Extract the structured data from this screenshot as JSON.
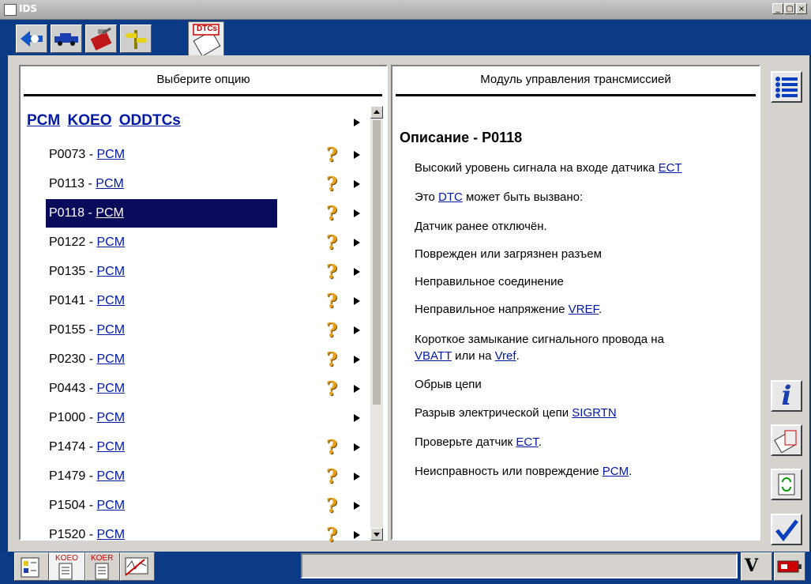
{
  "window": {
    "title": "IDS",
    "min_label": "_",
    "max_label": "▢",
    "close_label": "×"
  },
  "toolbar": {
    "tabs": [
      "back",
      "vehicle",
      "toolbox",
      "signpost"
    ],
    "dtc_tab_label": "DTCs"
  },
  "left_panel": {
    "header": "Выберите опцию",
    "group": {
      "pcm": "PCM",
      "koeo": "KOEO",
      "oddtcs": "ODDTCs"
    },
    "items": [
      {
        "code": "P0073",
        "sep": " - ",
        "module": "PCM",
        "help": true,
        "selected": false
      },
      {
        "code": "P0113",
        "sep": " - ",
        "module": "PCM",
        "help": true,
        "selected": false
      },
      {
        "code": "P0118",
        "sep": " - ",
        "module": "PCM",
        "help": true,
        "selected": true
      },
      {
        "code": "P0122",
        "sep": " - ",
        "module": "PCM",
        "help": true,
        "selected": false
      },
      {
        "code": "P0135",
        "sep": " - ",
        "module": "PCM",
        "help": true,
        "selected": false
      },
      {
        "code": "P0141",
        "sep": " - ",
        "module": "PCM",
        "help": true,
        "selected": false
      },
      {
        "code": "P0155",
        "sep": " - ",
        "module": "PCM",
        "help": true,
        "selected": false
      },
      {
        "code": "P0230",
        "sep": " - ",
        "module": "PCM",
        "help": true,
        "selected": false
      },
      {
        "code": "P0443",
        "sep": " - ",
        "module": "PCM",
        "help": true,
        "selected": false
      },
      {
        "code": "P1000",
        "sep": " - ",
        "module": "PCM",
        "help": false,
        "selected": false
      },
      {
        "code": "P1474",
        "sep": " - ",
        "module": "PCM",
        "help": true,
        "selected": false
      },
      {
        "code": "P1479",
        "sep": " - ",
        "module": "PCM",
        "help": true,
        "selected": false
      },
      {
        "code": "P1504",
        "sep": " - ",
        "module": "PCM",
        "help": true,
        "selected": false
      },
      {
        "code": "P1520",
        "sep": " - ",
        "module": "PCM",
        "help": true,
        "selected": false
      }
    ],
    "help_glyph": "?"
  },
  "right_panel": {
    "header": "Модуль управления трансмиссией",
    "title": "Описание - P0118",
    "lines": [
      [
        {
          "t": "Высокий уровень сигнала на входе датчика "
        },
        {
          "t": "ECT",
          "link": true
        }
      ],
      [
        {
          "t": "Это "
        },
        {
          "t": "DTC",
          "link": true
        },
        {
          "t": " может быть вызвано:"
        }
      ],
      [
        {
          "t": "Датчик ранее отключён."
        }
      ],
      [
        {
          "t": "Поврежден или загрязнен разъем"
        }
      ],
      [
        {
          "t": "Неправильное соединение"
        }
      ],
      [
        {
          "t": "Неправильное напряжение "
        },
        {
          "t": "VREF",
          "link": true
        },
        {
          "t": "."
        }
      ],
      [
        {
          "t": "Короткое замыкание сигнального провода на "
        },
        {
          "br": true
        },
        {
          "t": "VBATT",
          "link": true
        },
        {
          "t": " или на "
        },
        {
          "t": "Vref",
          "link": true
        },
        {
          "t": "."
        }
      ],
      [
        {
          "t": "Обрыв цепи"
        }
      ],
      [
        {
          "t": "Разрыв электрической цепи "
        },
        {
          "t": "SIGRTN",
          "link": true
        }
      ],
      [
        {
          "t": "Проверьте датчик "
        },
        {
          "t": "ECT",
          "link": true
        },
        {
          "t": "."
        }
      ],
      [
        {
          "t": "Неисправность или повреждение "
        },
        {
          "t": "PCM",
          "link": true
        },
        {
          "t": "."
        }
      ]
    ]
  },
  "side_buttons": {
    "info_label": "i"
  },
  "bottom": {
    "koeo_label": "KOEO",
    "koer_label": "KOER",
    "voltage_label": "V"
  }
}
